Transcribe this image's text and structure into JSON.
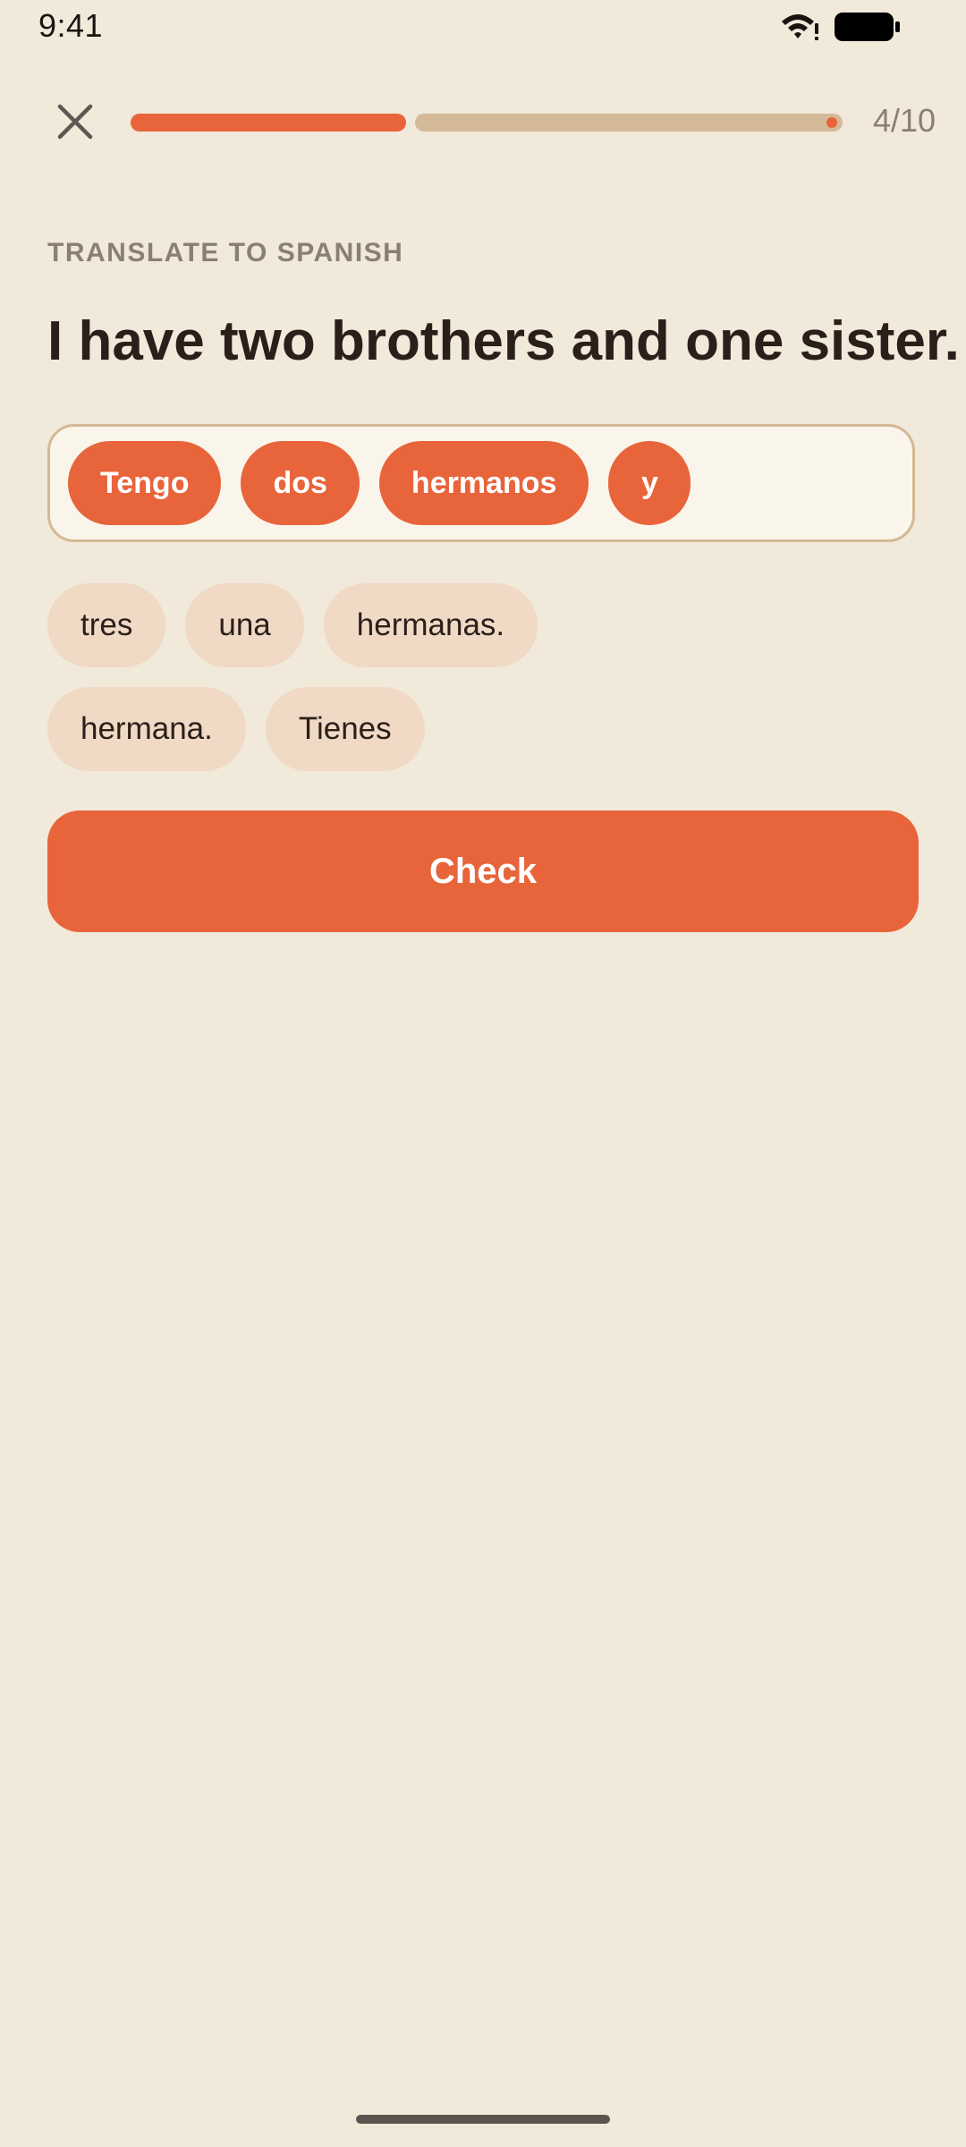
{
  "status_bar": {
    "time": "9:41",
    "icons": [
      "wifi-icon",
      "battery-icon"
    ]
  },
  "header": {
    "close_icon": "close-icon",
    "progress": {
      "current": 4,
      "total": 10,
      "label": "4/10"
    }
  },
  "exercise": {
    "instruction": "TRANSLATE TO SPANISH",
    "sentence": "I have two brothers and one sister.",
    "selected_words": [
      "Tengo",
      "dos",
      "hermanos",
      "y"
    ],
    "word_bank": [
      "tres",
      "una",
      "hermanas.",
      "hermana.",
      "Tienes"
    ]
  },
  "actions": {
    "check_label": "Check"
  },
  "colors": {
    "background": "#F1E9DA",
    "accent": "#E8643B",
    "track": "#D4BA99",
    "chip_bank": "#F0D9C5",
    "answer_box_bg": "#FAF5EB",
    "text_dark": "#2B1F1A",
    "text_muted": "#8A7F74"
  }
}
